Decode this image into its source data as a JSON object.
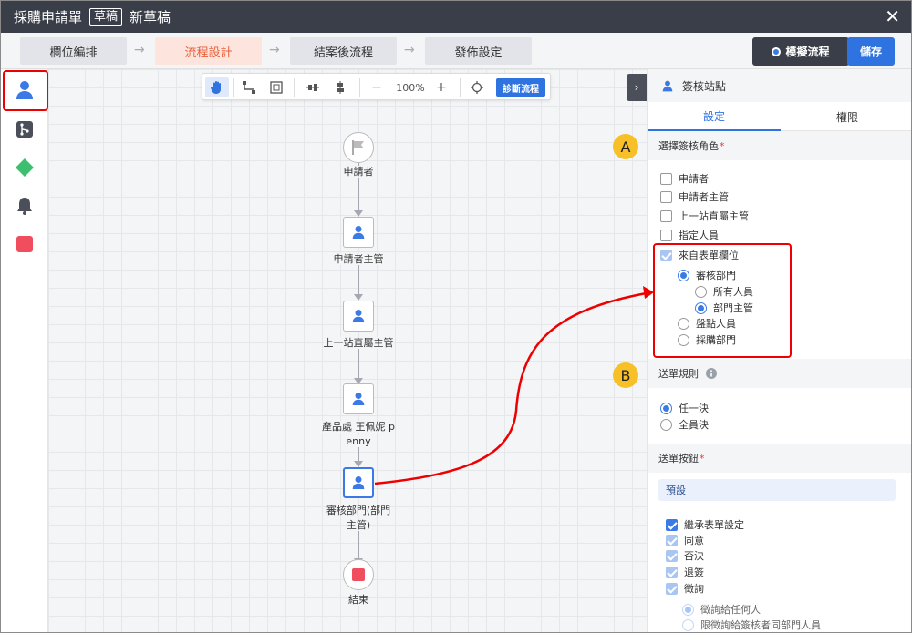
{
  "header": {
    "title": "採購申請單",
    "status_badge": "草稿",
    "doc_name": "新草稿",
    "close_label": "✕"
  },
  "steps": [
    {
      "label": "欄位編排",
      "active": false
    },
    {
      "label": "流程設計",
      "active": true
    },
    {
      "label": "結案後流程",
      "active": false
    },
    {
      "label": "發佈設定",
      "active": false
    }
  ],
  "actions": {
    "simulate_label": "模擬流程",
    "save_label": "儲存"
  },
  "sidebar": {
    "icons": [
      "person-icon",
      "branch-icon",
      "diamond-icon",
      "bell-icon",
      "stop-icon"
    ]
  },
  "toolbar": {
    "zoom_level": "100%",
    "minus": "−",
    "plus": "+",
    "diagnose_label": "診斷流程"
  },
  "flow": {
    "nodes": [
      {
        "label": "申請者",
        "type": "start"
      },
      {
        "label": "申請者主管",
        "type": "approver"
      },
      {
        "label": "上一站直屬主管",
        "type": "approver"
      },
      {
        "label_line1": "產品處 王佩妮 p",
        "label_line2": "enny",
        "type": "approver"
      },
      {
        "label_line1": "審核部門(部門",
        "label_line2": "主管)",
        "type": "approver",
        "selected": true
      },
      {
        "label": "結束",
        "type": "end"
      }
    ]
  },
  "panel": {
    "header_title": "簽核站點",
    "tabs": [
      "設定",
      "權限"
    ],
    "role_section": {
      "title": "選擇簽核角色",
      "required_mark": "*"
    },
    "roles": [
      {
        "label": "申請者",
        "checked": false
      },
      {
        "label": "申請者主管",
        "checked": false
      },
      {
        "label": "上一站直屬主管",
        "checked": false
      },
      {
        "label": "指定人員",
        "checked": false
      },
      {
        "label": "來自表單欄位",
        "checked": true
      }
    ],
    "field_options": {
      "audit_dept": "審核部門",
      "all_members": "所有人員",
      "dept_head": "部門主管",
      "inventory_staff": "盤點人員",
      "purchase_dept": "採購部門"
    },
    "send_rule": {
      "title": "送單規則",
      "options": [
        "任一決",
        "全員決"
      ],
      "selected": 0
    },
    "send_buttons": {
      "title": "送單按鈕",
      "required_mark": "*",
      "preset_label": "預設",
      "items": [
        {
          "label": "繼承表單設定",
          "checked": true
        },
        {
          "label": "同意",
          "checked": true
        },
        {
          "label": "否決",
          "checked": true
        },
        {
          "label": "退簽",
          "checked": true
        },
        {
          "label": "徵詢",
          "checked": true
        }
      ],
      "consult_options": [
        "徵詢給任何人",
        "限徵詢給簽核者同部門人員"
      ]
    }
  },
  "annotations": {
    "marker_a": "A",
    "marker_b": "B"
  },
  "colors": {
    "accent": "#2f73e0",
    "highlight": "#e00000",
    "active_step_bg": "#fde4dc",
    "active_step_text": "#e85f3a",
    "marker": "#f6c026"
  }
}
